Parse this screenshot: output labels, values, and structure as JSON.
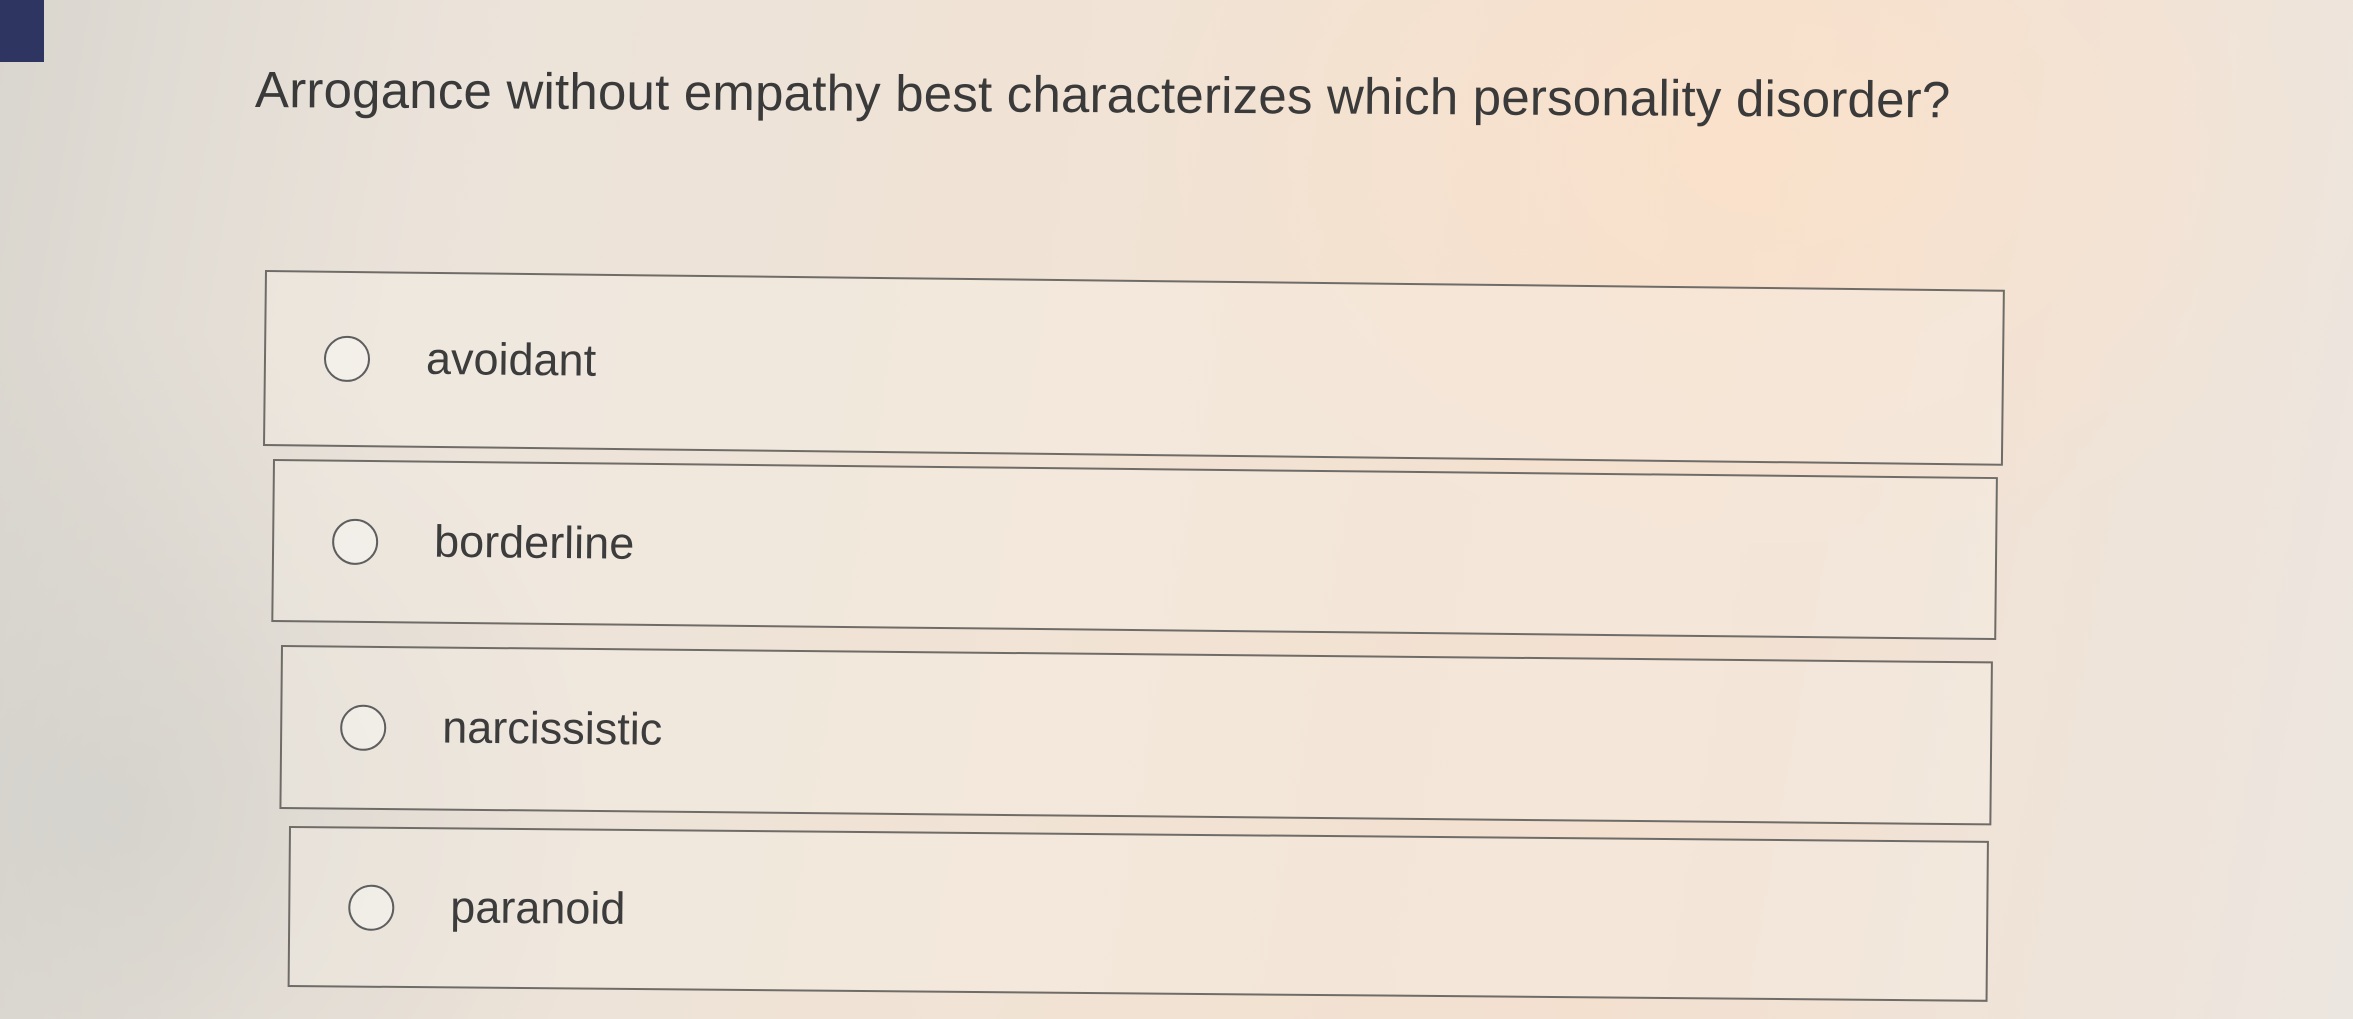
{
  "question": {
    "text": "Arrogance without empathy best characterizes which personality disorder?"
  },
  "options": [
    {
      "label": "avoidant",
      "selected": false
    },
    {
      "label": "borderline",
      "selected": false
    },
    {
      "label": "narcissistic",
      "selected": false
    },
    {
      "label": "paranoid",
      "selected": false
    }
  ],
  "colors": {
    "corner_tab": "#2d3560",
    "text": "#3a3a3a",
    "border": "#6f6c68"
  }
}
